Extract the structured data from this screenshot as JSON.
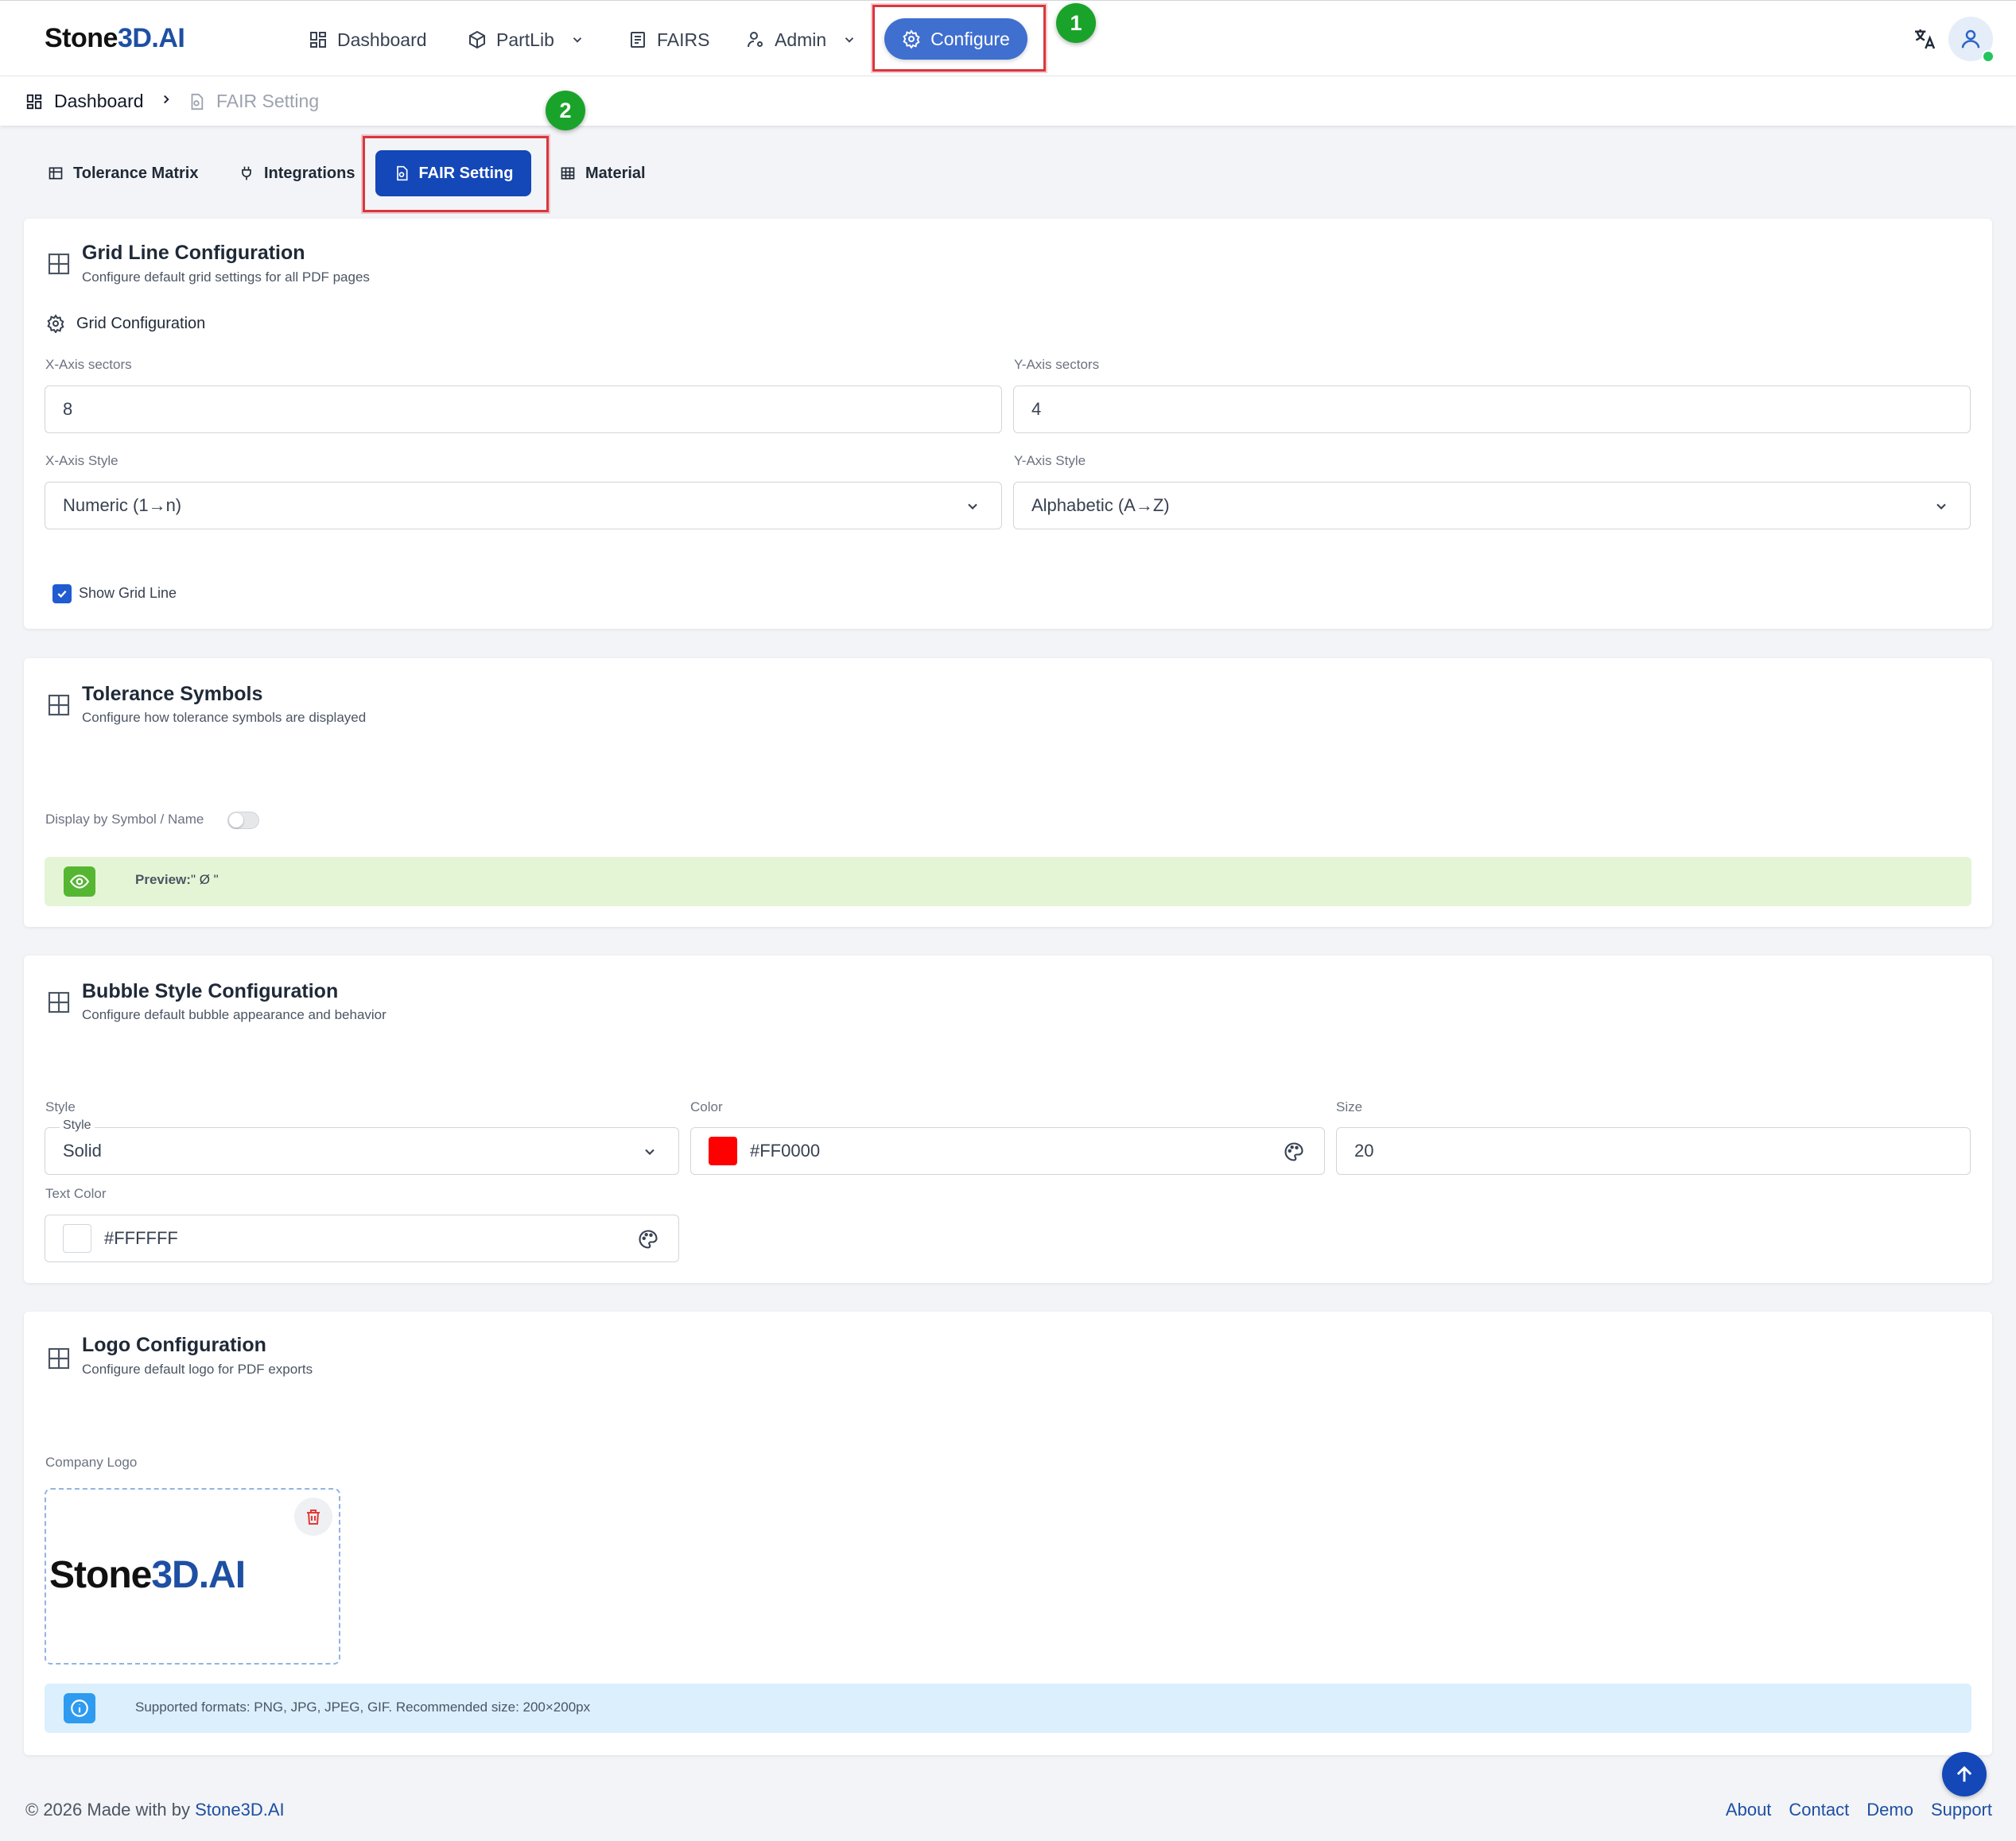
{
  "brand": {
    "prefix": "Stone",
    "accent": "3D.AI"
  },
  "nav": {
    "dashboard": "Dashboard",
    "partlib": "PartLib",
    "fairs": "FAIRS",
    "admin": "Admin",
    "configure": "Configure"
  },
  "annotations": {
    "step1": "1",
    "step2": "2"
  },
  "breadcrumb": {
    "home": "Dashboard",
    "current": "FAIR Setting"
  },
  "tabs": {
    "tolerance_matrix": "Tolerance Matrix",
    "integrations": "Integrations",
    "fair_setting": "FAIR Setting",
    "material": "Material"
  },
  "grid_card": {
    "title": "Grid Line Configuration",
    "subtitle": "Configure default grid settings for all PDF pages",
    "section": "Grid Configuration",
    "x_sectors_label": "X-Axis sectors",
    "x_sectors_value": "8",
    "y_sectors_label": "Y-Axis sectors",
    "y_sectors_value": "4",
    "x_style_label": "X-Axis Style",
    "x_style_value": "Numeric (1→n)",
    "y_style_label": "Y-Axis Style",
    "y_style_value": "Alphabetic (A→Z)",
    "show_grid_label": "Show Grid Line",
    "show_grid_checked": true
  },
  "tolerance_card": {
    "title": "Tolerance Symbols",
    "subtitle": "Configure how tolerance symbols are displayed",
    "toggle_label": "Display by Symbol / Name",
    "toggle_on": false,
    "preview_label": "Preview:",
    "preview_value": "\" Ø \""
  },
  "bubble_card": {
    "title": "Bubble Style Configuration",
    "subtitle": "Configure default bubble appearance and behavior",
    "style_label": "Style",
    "style_legend": "Style",
    "style_value": "Solid",
    "color_label": "Color",
    "color_value": "#FF0000",
    "color_swatch": "#FF0000",
    "size_label": "Size",
    "size_value": "20",
    "text_color_label": "Text Color",
    "text_color_value": "#FFFFFF",
    "text_color_swatch": "#FFFFFF"
  },
  "logo_card": {
    "title": "Logo Configuration",
    "subtitle": "Configure default logo for PDF exports",
    "company_logo_label": "Company Logo",
    "logo_prefix": "Stone",
    "logo_accent": "3D.AI",
    "info_text": "Supported formats: PNG, JPG, JPEG, GIF. Recommended size: 200×200px"
  },
  "footer": {
    "copyright": "© 2026 Made with by ",
    "brand_link": "Stone3D.AI",
    "links": [
      "About",
      "Contact",
      "Demo",
      "Support"
    ]
  },
  "colors": {
    "primary": "#1447B8",
    "configure": "#3F6FCF",
    "highlight": "#D9363E",
    "step_badge": "#1AA32A"
  }
}
